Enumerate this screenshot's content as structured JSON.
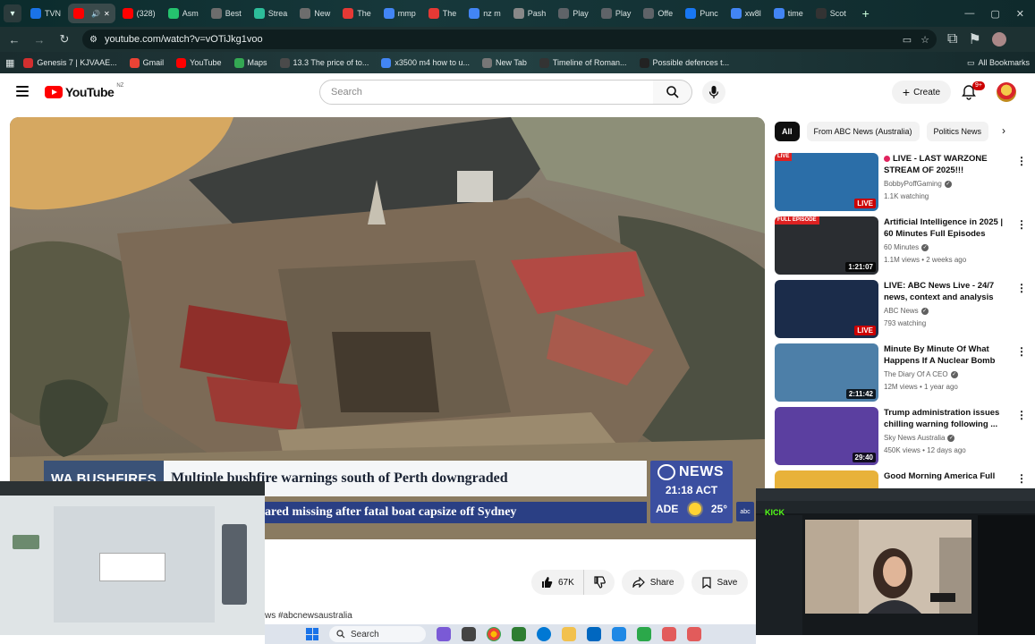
{
  "browser": {
    "tabs": [
      {
        "label": "TVN",
        "color": "#1a73e8"
      },
      {
        "label": "",
        "color": "#ff0000"
      },
      {
        "label": "(328)",
        "color": "#ff0000"
      },
      {
        "label": "Asm",
        "color": "#25c26e"
      },
      {
        "label": "Best",
        "color": "#6d6d6d"
      },
      {
        "label": "Strea",
        "color": "#2dbd9a"
      },
      {
        "label": "New",
        "color": "#6d6d6d"
      },
      {
        "label": "The",
        "color": "#e53935"
      },
      {
        "label": "mmp",
        "color": "#4285f4"
      },
      {
        "label": "The",
        "color": "#e53935"
      },
      {
        "label": "nz m",
        "color": "#4285f4"
      },
      {
        "label": "Pash",
        "color": "#888888"
      },
      {
        "label": "Play",
        "color": "#5f6368"
      },
      {
        "label": "Play",
        "color": "#5f6368"
      },
      {
        "label": "Offe",
        "color": "#5f6368"
      },
      {
        "label": "Punc",
        "color": "#1877f2"
      },
      {
        "label": "xw8l",
        "color": "#4285f4"
      },
      {
        "label": "time",
        "color": "#4285f4"
      },
      {
        "label": "Scot",
        "color": "#333333"
      }
    ],
    "active_tab_index": 1,
    "url": "youtube.com/watch?v=vOTiJkg1voo",
    "bookmarks": [
      {
        "label": "Genesis 7 | KJVAAE...",
        "color": "#d32f2f"
      },
      {
        "label": "Gmail",
        "color": "#ea4335"
      },
      {
        "label": "YouTube",
        "color": "#ff0000"
      },
      {
        "label": "Maps",
        "color": "#34a853"
      },
      {
        "label": "13.3 The price of to...",
        "color": "#4a4a4a"
      },
      {
        "label": "x3500 m4 how to u...",
        "color": "#4285f4"
      },
      {
        "label": "New Tab",
        "color": "#777777"
      },
      {
        "label": "Timeline of Roman...",
        "color": "#333333"
      },
      {
        "label": "Possible defences t...",
        "color": "#222222"
      }
    ],
    "all_bookmarks_label": "All Bookmarks"
  },
  "youtube": {
    "logo_text": "YouTube",
    "country_code": "NZ",
    "search_placeholder": "Search",
    "create_label": "Create",
    "notification_badge": "9+",
    "player": {
      "lower_third_tag": "WA BUSHFIRES",
      "lower_third_headline": "Multiple bushfire warnings south of Perth downgraded",
      "ticker_text": "ared missing after fatal boat capsize off Sydney",
      "network": "NEWS",
      "time": "21:18 ACT",
      "weather_city": "ADE",
      "weather_temp": "25°",
      "small_logo": "abc"
    },
    "actions": {
      "like_count": "67K",
      "share_label": "Share",
      "save_label": "Save"
    },
    "hashtags": "ws #abcnewsaustralia",
    "chips": [
      "All",
      "From ABC News (Australia)",
      "Politics News"
    ],
    "recommendations": [
      {
        "title": "LIVE - LAST WARZONE STREAM OF 2025!!!",
        "channel": "BobbyPoffGaming",
        "meta": "1.1K watching",
        "badge": "LIVE",
        "live": true,
        "thumb_tag": "LIVE",
        "thumb_color": "#2b6ea8"
      },
      {
        "title": "Artificial Intelligence in 2025 | 60 Minutes Full Episodes",
        "channel": "60 Minutes",
        "meta": "1.1M views • 2 weeks ago",
        "badge": "1:21:07",
        "live": false,
        "thumb_tag": "FULL EPISODE",
        "thumb_color": "#2a2d31"
      },
      {
        "title": "LIVE: ABC News Live - 24/7 news, context and analysis",
        "channel": "ABC News",
        "meta": "793 watching",
        "badge": "LIVE",
        "live": true,
        "thumb_tag": "",
        "thumb_color": "#1b2c4a"
      },
      {
        "title": "Minute By Minute Of What Happens If A Nuclear Bomb ...",
        "channel": "The Diary Of A CEO",
        "meta": "12M views • 1 year ago",
        "badge": "2:11:42",
        "live": false,
        "thumb_tag": "",
        "thumb_color": "#4d7fa8"
      },
      {
        "title": "Trump administration issues chilling warning following ...",
        "channel": "Sky News Australia",
        "meta": "450K views • 12 days ago",
        "badge": "29:40",
        "live": false,
        "thumb_tag": "",
        "thumb_color": "#5b3fa0"
      },
      {
        "title": "Good Morning America Full",
        "channel": "",
        "meta": "",
        "badge": "",
        "live": false,
        "thumb_tag": "",
        "thumb_color": "#e8b23a"
      }
    ]
  },
  "overlay": {
    "kick_logo": "KICK"
  },
  "taskbar": {
    "search_label": "Search"
  }
}
